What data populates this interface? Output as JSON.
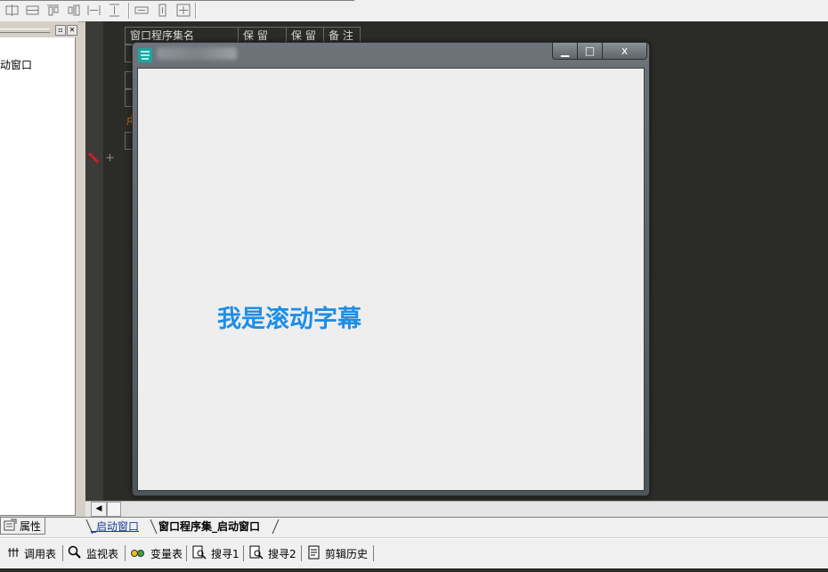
{
  "toolbar": {
    "icons": [
      "align-left-icon",
      "align-center-icon",
      "align-top-icon",
      "align-middle-icon",
      "same-width-icon",
      "same-height-icon",
      "h-space-icon",
      "v-space-icon",
      "center-icon"
    ]
  },
  "left_panel": {
    "tree_item": "动窗口",
    "prop_tab": "属性"
  },
  "editor": {
    "headers": [
      "窗口程序集名",
      "保 留",
      "保 留",
      "备 注"
    ],
    "orange_char": "虍"
  },
  "tabs": {
    "tab1": "_启动窗口",
    "tab2": "窗口程序集_启动窗口"
  },
  "bottom_toolbar": {
    "items": [
      "调用表",
      "监视表",
      "变量表",
      "搜寻1",
      "搜寻2",
      "剪辑历史"
    ]
  },
  "popup": {
    "marquee_text": "我是滚动字幕",
    "min_glyph": "▁",
    "max_glyph": "□",
    "close_glyph": "x"
  },
  "colors": {
    "marquee": "#1d8ee6",
    "editor_bg": "#2b2b28",
    "window_frame": "#5e656a"
  }
}
